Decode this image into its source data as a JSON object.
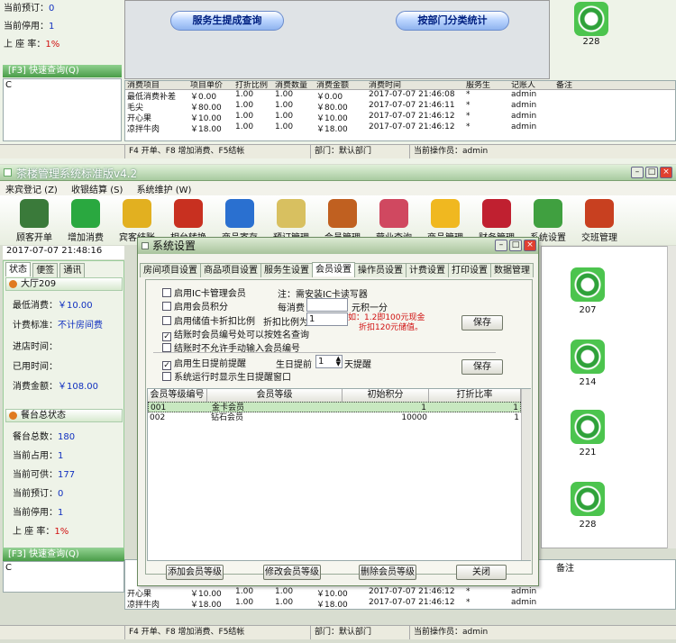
{
  "bg_window": {
    "stats": [
      {
        "label": "当前预订：",
        "value": "0"
      },
      {
        "label": "当前停用：",
        "value": "1"
      },
      {
        "label": "上 座 率：",
        "value": "1%"
      }
    ],
    "quick_search_label": "[F3] 快速查询(Q)",
    "quick_search_value": "C",
    "buttons": [
      "服务生提成查询",
      "按部门分类统计"
    ],
    "table_headers": [
      "消费项目",
      "项目单价",
      "打折比例",
      "消费数量",
      "消费金额",
      "消费时间",
      "服务生",
      "记账人",
      "备注"
    ],
    "rows": [
      [
        "最低消费补差",
        "￥0.00",
        "1.00",
        "1.00",
        "￥0.00",
        "2017-07-07 21:46:08",
        "*",
        "admin"
      ],
      [
        "毛尖",
        "￥80.00",
        "1.00",
        "1.00",
        "￥80.00",
        "2017-07-07 21:46:11",
        "*",
        "admin"
      ],
      [
        "开心果",
        "￥10.00",
        "1.00",
        "1.00",
        "￥10.00",
        "2017-07-07 21:46:12",
        "*",
        "admin"
      ],
      [
        "凉拌牛肉",
        "￥18.00",
        "1.00",
        "1.00",
        "￥18.00",
        "2017-07-07 21:46:12",
        "*",
        "admin"
      ]
    ],
    "status": {
      "hint": "F4 开单、F8 增加消费、F5结帐",
      "dept": "部门：默认部门",
      "operator": "当前操作员：admin"
    },
    "tile_label": "228"
  },
  "main_window": {
    "title": "茶楼管理系统标准版v4.2",
    "menu": [
      "来宾登记 (Z)",
      "收银结算 (S)",
      "系统维护 (W)"
    ],
    "toolbar": [
      {
        "label": "顾客开单",
        "icon": "tea-cup-icon",
        "color": "#3a7a3a"
      },
      {
        "label": "增加消费",
        "icon": "add-cross-icon",
        "color": "#2aa840"
      },
      {
        "label": "宾客结账",
        "icon": "arrow-icon",
        "color": "#e2b020"
      },
      {
        "label": "相台转换",
        "icon": "camera-icon",
        "color": "#c83020"
      },
      {
        "label": "商品寄存",
        "icon": "basket-icon",
        "color": "#2a70d0"
      },
      {
        "label": "预订管理",
        "icon": "clock-icon",
        "color": "#d8c060"
      },
      {
        "label": "会员管理",
        "icon": "people-icon",
        "color": "#c06020"
      },
      {
        "label": "营业查询",
        "icon": "pen-icon",
        "color": "#d04860"
      },
      {
        "label": "商品管理",
        "icon": "star-icon",
        "color": "#f0b820"
      },
      {
        "label": "财务管理",
        "icon": "calculator-icon",
        "color": "#c02030"
      },
      {
        "label": "系统设置",
        "icon": "gear-icon",
        "color": "#40a040"
      },
      {
        "label": "交班管理",
        "icon": "exit-door-icon",
        "color": "#c84020"
      }
    ],
    "datetime": "2017-07-07 21:48:16",
    "left_tabs": [
      "状态",
      "便签",
      "通讯"
    ],
    "hall": {
      "name": "大厅209",
      "min_spend_label": "最低消费：",
      "min_spend": "￥10.00",
      "billing_label": "计费标准：",
      "billing": "不计房间费",
      "enter_label": "进店时间：",
      "used_label": "已用时间：",
      "amount_label": "消费金额：",
      "amount": "￥108.00"
    },
    "table_status": {
      "title": "餐台总状态",
      "items": [
        {
          "label": "餐台总数：",
          "value": "180"
        },
        {
          "label": "当前占用：",
          "value": "1"
        },
        {
          "label": "当前可供：",
          "value": "177"
        },
        {
          "label": "当前预订：",
          "value": "0"
        },
        {
          "label": "当前停用：",
          "value": "1"
        },
        {
          "label": "上 座 率：",
          "value": "1%"
        }
      ]
    },
    "quick_search_label": "[F3] 快速查询(Q)",
    "quick_search_value": "C",
    "tiles": [
      "207",
      "214",
      "221",
      "228"
    ],
    "bottom_rows": [
      [
        "开心果",
        "￥10.00",
        "1.00",
        "1.00",
        "￥10.00",
        "2017-07-07 21:46:12",
        "*",
        "admin"
      ],
      [
        "凉拌牛肉",
        "￥18.00",
        "1.00",
        "1.00",
        "￥18.00",
        "2017-07-07 21:46:12",
        "*",
        "admin"
      ]
    ],
    "bottom_remark_header": "备注",
    "status": {
      "hint": "F4 开单、F8 增加消费、F5结帐",
      "dept": "部门：默认部门",
      "operator": "当前操作员：admin"
    }
  },
  "dialog": {
    "title": "系统设置",
    "tabs": [
      "房间项目设置",
      "商品项目设置",
      "服务生设置",
      "会员设置",
      "操作员设置",
      "计费设置",
      "打印设置",
      "数据管理"
    ],
    "active_tab": 3,
    "opt_ic": "启用IC卡管理会员",
    "ic_note": "注：需安装IC卡读写器",
    "opt_points": "启用会员积分",
    "per_spend_label": "每消费",
    "per_spend_value": "",
    "points_unit": "元积一分",
    "opt_discount": "启用储值卡折扣比例",
    "discount_label": "折扣比例为",
    "discount_value": "1",
    "discount_hint1": "如：1.2即100元现金",
    "discount_hint2": "折扣120元储值。",
    "save_label": "保存",
    "opt_query": "结账时会员编号处可以按姓名查询",
    "opt_noinput": "结账时不允许手动输入会员编号",
    "opt_birthday": "启用生日提前提醒",
    "birthday_label": "生日提前",
    "birthday_value": "1",
    "birthday_unit": "天提醒",
    "opt_popup": "系统运行时显示生日提醒窗口",
    "grade_headers": [
      "会员等级编号",
      "会员等级",
      "初始积分",
      "打折比率"
    ],
    "grades": [
      {
        "code": "001",
        "name": "金卡会员",
        "points": "1",
        "rate": "1"
      },
      {
        "code": "002",
        "name": "钻石会员",
        "points": "10000",
        "rate": "1"
      }
    ],
    "buttons": [
      "添加会员等级",
      "修改会员等级",
      "删除会员等级",
      "关闭"
    ]
  },
  "colors": {
    "accent": "#4a9c48",
    "warn": "#d01010"
  }
}
